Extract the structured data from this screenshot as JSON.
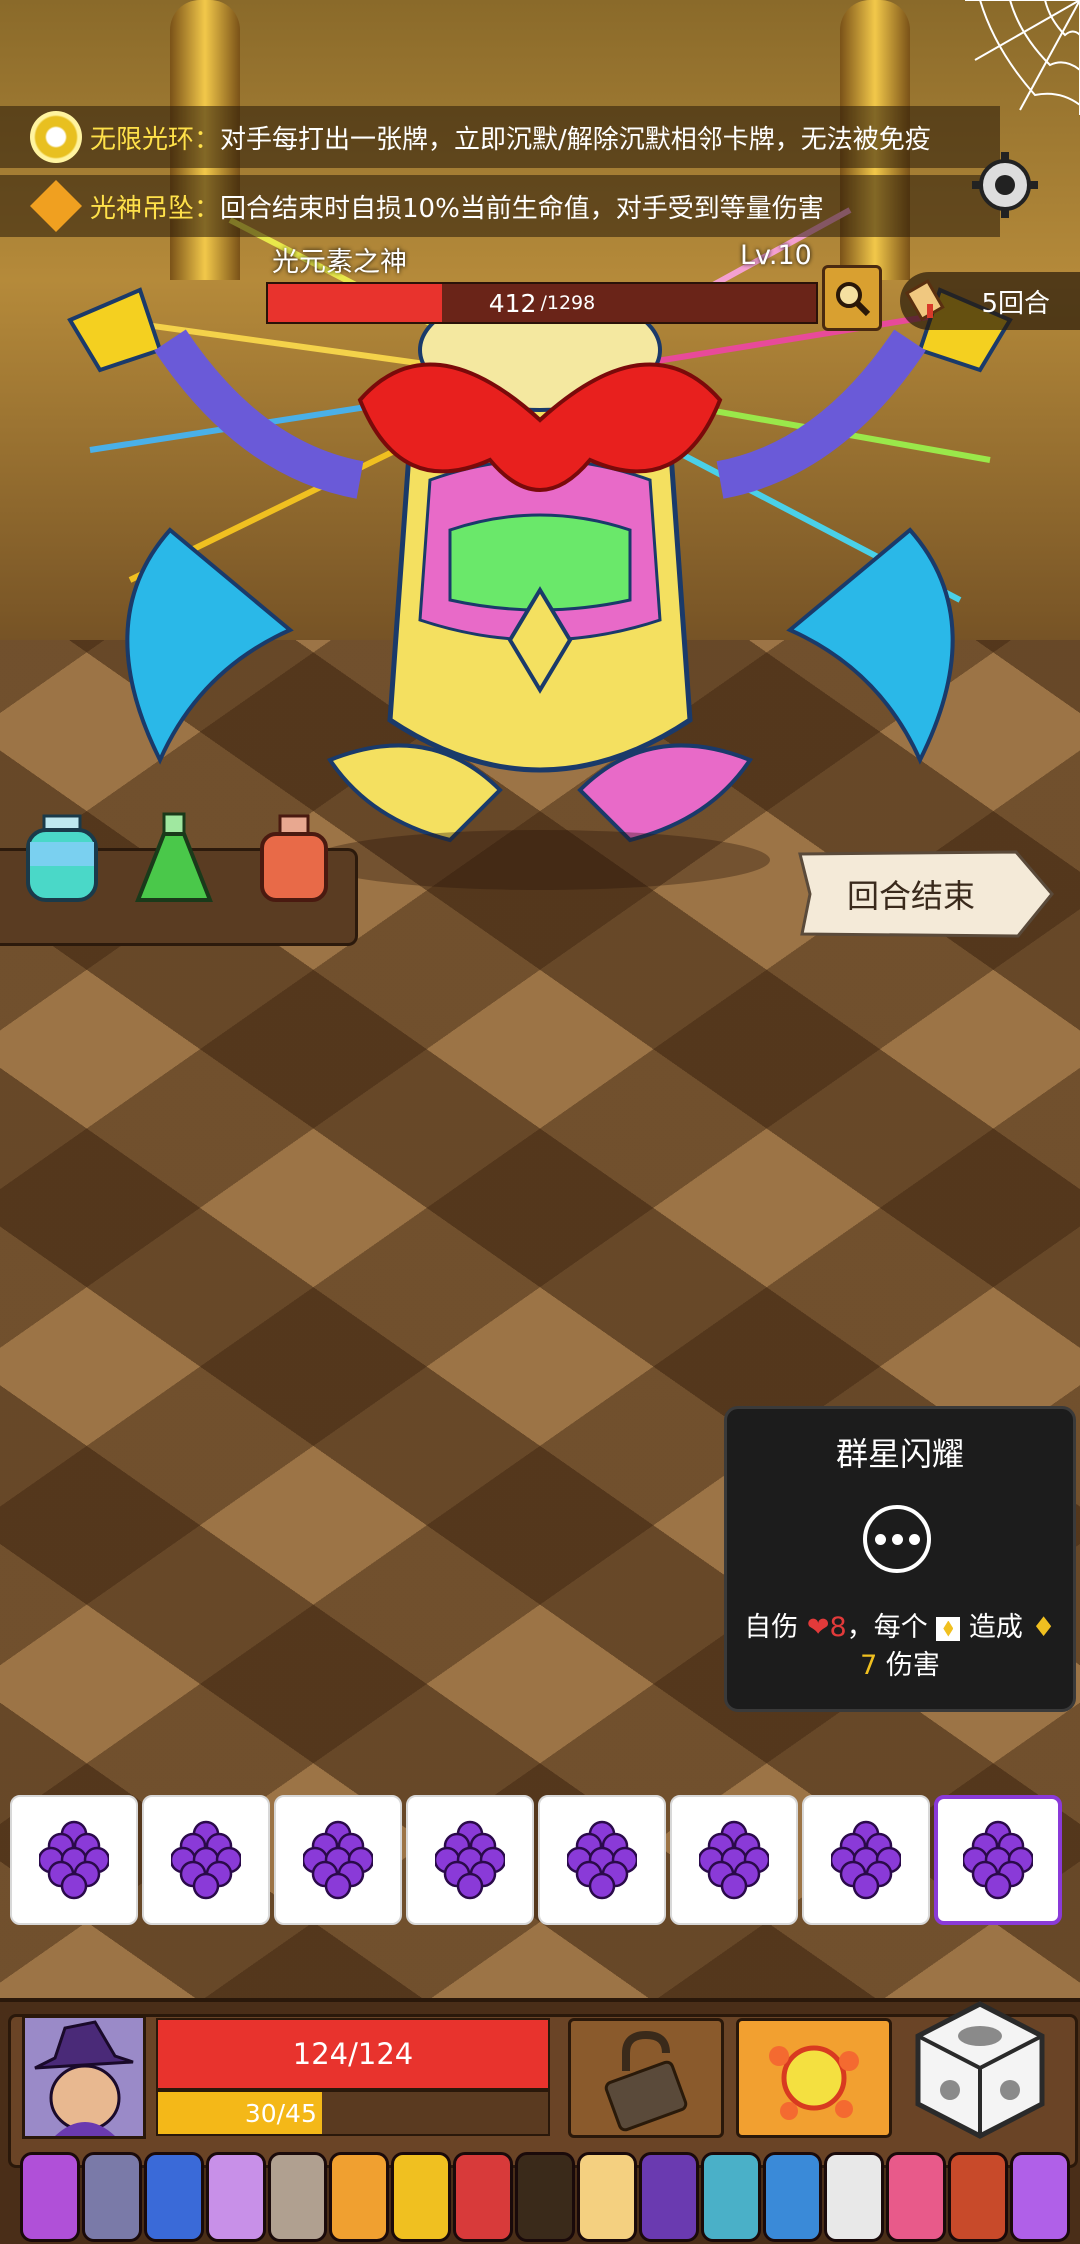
{
  "buffs": [
    {
      "name": "无限光环：",
      "desc": "对手每打出一张牌，立即沉默/解除沉默相邻卡牌，无法被免疫"
    },
    {
      "name": "光神吊坠：",
      "desc": "回合结束时自损10%当前生命值，对手受到等量伤害"
    }
  ],
  "boss": {
    "name": "光元素之神",
    "level": "Lv.10",
    "hp_current": "412",
    "hp_max": "/1298",
    "hp_fraction": 0.317
  },
  "round": "5回合",
  "end_turn_label": "回合结束",
  "card_tip": {
    "title": "群星闪耀",
    "desc_part1": "自伤",
    "self_damage": "8",
    "desc_part2": "，每个",
    "desc_part3": "造成",
    "damage": "7",
    "desc_part4": "伤害"
  },
  "dice": [
    {
      "face": "grape-icon",
      "selected": false
    },
    {
      "face": "grape-icon",
      "selected": false
    },
    {
      "face": "grape-icon",
      "selected": false
    },
    {
      "face": "grape-icon",
      "selected": false
    },
    {
      "face": "grape-icon",
      "selected": false
    },
    {
      "face": "grape-icon",
      "selected": false
    },
    {
      "face": "grape-icon",
      "selected": false
    },
    {
      "face": "grape-icon",
      "selected": true
    }
  ],
  "player": {
    "hp": "124/124",
    "energy": "30/45",
    "energy_fraction": 0.667
  },
  "colors": {
    "hp": "#e8332d",
    "energy": "#f4b818",
    "grape": "#8a3ad8"
  },
  "relic_colors": [
    "#b050d8",
    "#7a7aa8",
    "#3a6ad8",
    "#c890e8",
    "#b0a090",
    "#f0a030",
    "#f0c020",
    "#d83a3a",
    "#3a2a1a",
    "#f4d080",
    "#6a3ab0",
    "#4ab0c8",
    "#3a8ad8",
    "#e8e8e8",
    "#e85a8a",
    "#c84a2a",
    "#b060e8"
  ]
}
